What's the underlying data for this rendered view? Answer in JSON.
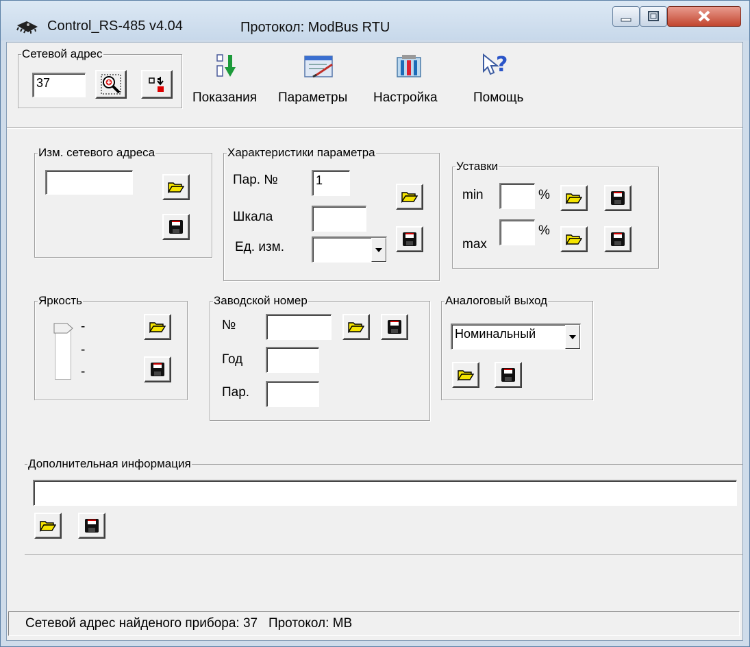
{
  "window": {
    "title": "Control_RS-485 v4.04",
    "protocol_title": "Протокол: ModBus RTU"
  },
  "toolbar": {
    "net_address_group": "Сетевой адрес",
    "net_address_value": "37",
    "readings_label": "Показания",
    "params_label": "Параметры",
    "settings_label": "Настройка",
    "help_label": "Помощь"
  },
  "change_address": {
    "title": "Изм. сетевого адреса",
    "value": ""
  },
  "param_chars": {
    "title": "Характеристики параметра",
    "par_no_label": "Пар. №",
    "par_no_value": "1",
    "scale_label": "Шкала",
    "scale_value": "",
    "unit_label": "Ед. изм.",
    "unit_value": ""
  },
  "setpoints": {
    "title": "Уставки",
    "min_label": "min",
    "max_label": "max",
    "percent": "%",
    "min_value": "",
    "max_value": ""
  },
  "brightness": {
    "title": "Яркость",
    "tick": "-"
  },
  "serial": {
    "title": "Заводской номер",
    "no_label": "№",
    "year_label": "Год",
    "par_label": "Пар.",
    "no_value": "",
    "year_value": "",
    "par_value": ""
  },
  "analog": {
    "title": "Аналоговый выход",
    "selected": "Номинальный"
  },
  "extra": {
    "title": "Дополнительная информация",
    "value": ""
  },
  "statusbar": {
    "text": "Сетевой адрес найденого прибора: 37   Протокол: MB"
  },
  "colors": {
    "folder": "#f5e400",
    "disk": "#101010",
    "disk_accent": "#cc0000"
  }
}
